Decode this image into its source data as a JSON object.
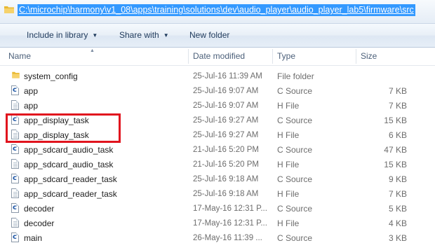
{
  "address_bar": {
    "path": "C:\\microchip\\harmony\\v1_08\\apps\\training\\solutions\\dev\\audio_player\\audio_player_lab5\\firmware\\src",
    "icon": "folder-icon"
  },
  "toolbar": {
    "include_in_library": "Include in library",
    "share_with": "Share with",
    "new_folder": "New folder"
  },
  "columns": {
    "name": "Name",
    "date_modified": "Date modified",
    "type": "Type",
    "size": "Size"
  },
  "files": [
    {
      "name": "system_config",
      "date": "25-Jul-16 11:39 AM",
      "type": "File folder",
      "size": "",
      "icon": "folder-icon"
    },
    {
      "name": "app",
      "date": "25-Jul-16 9:07 AM",
      "type": "C Source",
      "size": "7 KB",
      "icon": "c-source-file-icon"
    },
    {
      "name": "app",
      "date": "25-Jul-16 9:07 AM",
      "type": "H File",
      "size": "7 KB",
      "icon": "h-file-icon"
    },
    {
      "name": "app_display_task",
      "date": "25-Jul-16 9:27 AM",
      "type": "C Source",
      "size": "15 KB",
      "icon": "c-source-file-icon"
    },
    {
      "name": "app_display_task",
      "date": "25-Jul-16 9:27 AM",
      "type": "H File",
      "size": "6 KB",
      "icon": "h-file-icon"
    },
    {
      "name": "app_sdcard_audio_task",
      "date": "21-Jul-16 5:20 PM",
      "type": "C Source",
      "size": "47 KB",
      "icon": "c-source-file-icon"
    },
    {
      "name": "app_sdcard_audio_task",
      "date": "21-Jul-16 5:20 PM",
      "type": "H File",
      "size": "15 KB",
      "icon": "h-file-icon"
    },
    {
      "name": "app_sdcard_reader_task",
      "date": "25-Jul-16 9:18 AM",
      "type": "C Source",
      "size": "9 KB",
      "icon": "c-source-file-icon"
    },
    {
      "name": "app_sdcard_reader_task",
      "date": "25-Jul-16 9:18 AM",
      "type": "H File",
      "size": "7 KB",
      "icon": "h-file-icon"
    },
    {
      "name": "decoder",
      "date": "17-May-16 12:31 P...",
      "type": "C Source",
      "size": "5 KB",
      "icon": "c-source-file-icon"
    },
    {
      "name": "decoder",
      "date": "17-May-16 12:31 P...",
      "type": "H File",
      "size": "4 KB",
      "icon": "h-file-icon"
    },
    {
      "name": "main",
      "date": "26-May-16 11:39 ...",
      "type": "C Source",
      "size": "3 KB",
      "icon": "c-source-file-icon"
    }
  ],
  "colors": {
    "selection": "#3399ff",
    "highlight_box": "#e1141e",
    "folder": "#f2c94c"
  }
}
